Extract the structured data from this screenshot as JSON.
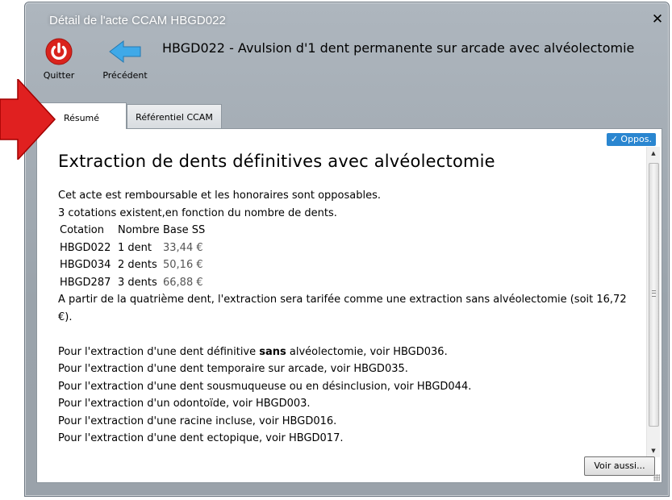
{
  "window": {
    "title": "Détail de l'acte CCAM HBGD022",
    "close_glyph": "✕"
  },
  "toolbar": {
    "quit_label": "Quitter",
    "back_label": "Précédent",
    "quit_icon": "power-icon",
    "back_icon": "back-arrow-icon",
    "quit_color": "#d9231c",
    "back_color": "#3fa9e8"
  },
  "acte": {
    "heading": "HBGD022 - Avulsion d'1 dent permanente sur arcade avec alvéolectomie"
  },
  "tabs": [
    {
      "label": "Résumé",
      "selected": true
    },
    {
      "label": "Référentiel CCAM",
      "selected": false
    }
  ],
  "badge": {
    "label": "✓ Oppos.",
    "color": "#2a86d0"
  },
  "content": {
    "title": "Extraction de dents définitives avec alvéolectomie",
    "intro_lines": [
      "Cet acte est remboursable et les honoraires sont opposables.",
      "3 cotations existent,en fonction du nombre de dents."
    ],
    "cotation_table": {
      "headers": [
        "Cotation",
        "Nombre",
        "Base SS"
      ],
      "rows": [
        [
          "HBGD022",
          "1 dent",
          "33,44 €"
        ],
        [
          "HBGD034",
          "2 dents",
          "50,16 €"
        ],
        [
          "HBGD287",
          "3 dents",
          "66,88 €"
        ]
      ]
    },
    "note": "A partir de la quatrième dent, l'extraction sera tarifée comme une extraction sans alvéolectomie (soit 16,72 €).",
    "see_also_first": {
      "before": "Pour l'extraction d'une dent définitive ",
      "bold": "sans",
      "after": " alvéolectomie, voir HBGD036."
    },
    "see_also": [
      "Pour l'extraction d'une dent temporaire sur arcade, voir HBGD035.",
      "Pour l'extraction d'une dent sousmuqueuse ou en désinclusion, voir HBGD044.",
      "Pour l'extraction d'un odontoïde, voir HBGD003.",
      "Pour l'extraction d'une racine incluse, voir HBGD016.",
      "Pour l'extraction d'une dent ectopique, voir HBGD017."
    ]
  },
  "footer": {
    "voir_aussi_label": "Voir aussi..."
  },
  "annotation": {
    "arrow_color": "#e02020",
    "icon": "red-arrow-icon"
  }
}
